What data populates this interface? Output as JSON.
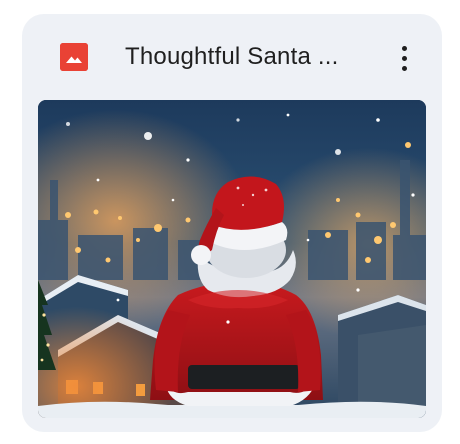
{
  "card": {
    "title": "Thoughtful Santa ...",
    "file_type_icon": "image-icon",
    "menu_icon": "more-vertical-icon",
    "thumbnail_subject": "Santa Claus seen from behind overlooking a snowy city at night",
    "colors": {
      "card_background": "#eef1f6",
      "icon_red": "#e94235",
      "text": "#1f1f1f"
    }
  }
}
